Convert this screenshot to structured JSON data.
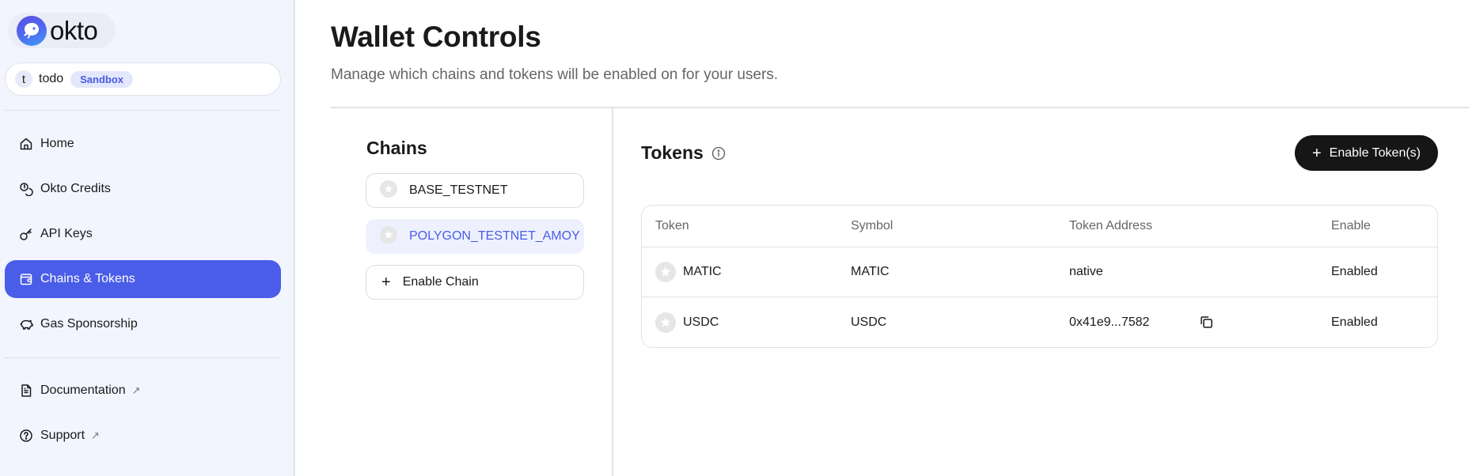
{
  "brand": {
    "name": "okto",
    "logo_icon": "okto-octopus-logo-icon"
  },
  "workspace": {
    "avatar_letter": "t",
    "name": "todo",
    "environment_badge": "Sandbox"
  },
  "sidebar": {
    "nav_items": [
      {
        "label": "Home",
        "icon": "home-icon",
        "active": false
      },
      {
        "label": "Okto Credits",
        "icon": "coins-icon",
        "active": false
      },
      {
        "label": "API Keys",
        "icon": "key-icon",
        "active": false
      },
      {
        "label": "Chains & Tokens",
        "icon": "wallet-icon",
        "active": true
      },
      {
        "label": "Gas Sponsorship",
        "icon": "piggy-bank-icon",
        "active": false
      }
    ],
    "footer_items": [
      {
        "label": "Documentation",
        "icon": "document-icon",
        "external": true
      },
      {
        "label": "Support",
        "icon": "help-circle-icon",
        "external": true
      }
    ]
  },
  "page": {
    "title": "Wallet Controls",
    "subtitle": "Manage which chains and tokens will be enabled on for your users."
  },
  "chains": {
    "title": "Chains",
    "items": [
      {
        "name": "BASE_TESTNET",
        "selected": false
      },
      {
        "name": "POLYGON_TESTNET_AMOY",
        "selected": true
      }
    ],
    "add_label": "Enable Chain"
  },
  "tokens": {
    "title": "Tokens",
    "enable_button_label": "Enable Token(s)",
    "columns": [
      "Token",
      "Symbol",
      "Token Address",
      "Enable"
    ],
    "rows": [
      {
        "token": "MATIC",
        "symbol": "MATIC",
        "address": "native",
        "copyable": false,
        "status": "Enabled"
      },
      {
        "token": "USDC",
        "symbol": "USDC",
        "address": "0x41e9...7582",
        "copyable": true,
        "status": "Enabled"
      }
    ]
  },
  "colors": {
    "accent": "#4a5de8",
    "sidebar_bg": "#f2f5fe",
    "primary_button_bg": "#161616",
    "badge_bg": "#e3e7fb"
  }
}
